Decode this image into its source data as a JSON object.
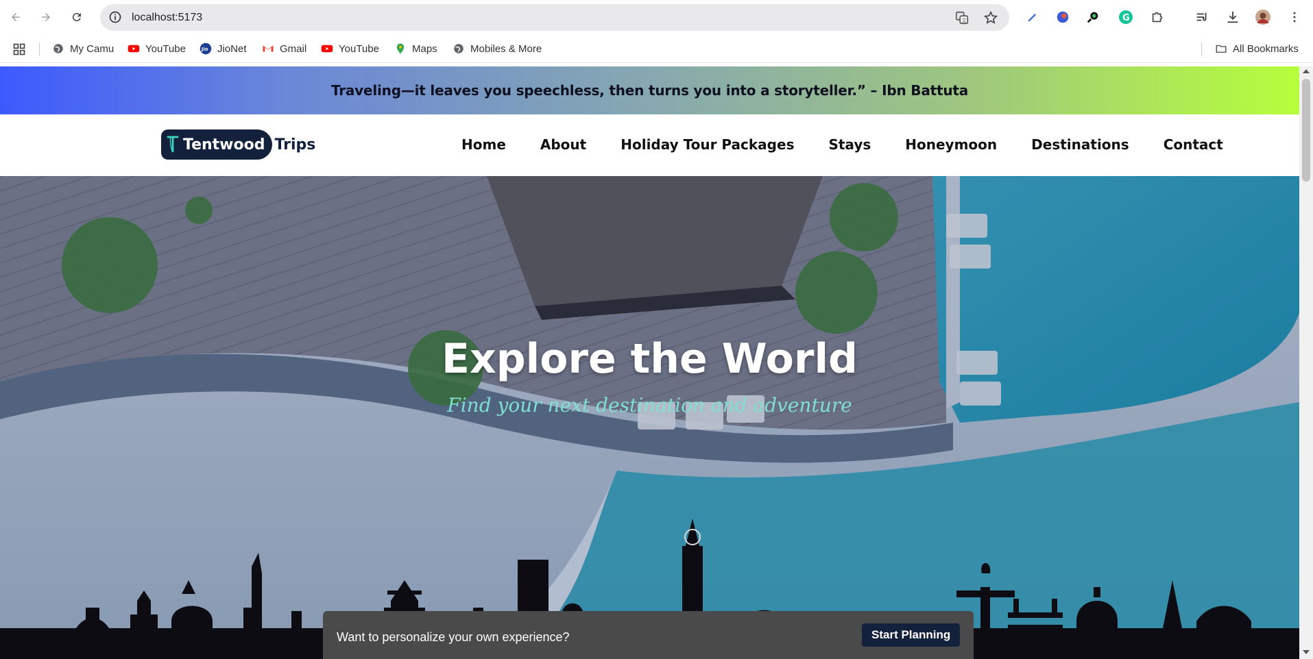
{
  "browser": {
    "url": "localhost:5173",
    "bookmarks": [
      {
        "label": "My Camu",
        "icon": "globe-icon"
      },
      {
        "label": "YouTube",
        "icon": "youtube-icon"
      },
      {
        "label": "JioNet",
        "icon": "jio-icon"
      },
      {
        "label": "Gmail",
        "icon": "gmail-icon"
      },
      {
        "label": "YouTube",
        "icon": "youtube-icon"
      },
      {
        "label": "Maps",
        "icon": "maps-icon"
      },
      {
        "label": "Mobiles & More",
        "icon": "globe-icon"
      }
    ],
    "all_bookmarks_label": "All Bookmarks"
  },
  "page": {
    "quote": "Traveling—it leaves you speechless, then turns you into a storyteller.” – Ibn Battuta",
    "logo": {
      "brand": "Tentwood",
      "suffix": "Trips"
    },
    "nav": [
      "Home",
      "About",
      "Holiday Tour Packages",
      "Stays",
      "Honeymoon",
      "Destinations",
      "Contact"
    ],
    "hero": {
      "title": "Explore the World",
      "subtitle": "Find your next destination and adventure"
    },
    "cta": {
      "text": "Want to personalize your own experience?",
      "button": "Start Planning"
    }
  },
  "colors": {
    "brand_navy": "#14213d",
    "subtitle_teal": "#7fe0d2",
    "quote_gradient_start": "#3d5afe",
    "quote_gradient_end": "#b6ff3b"
  }
}
